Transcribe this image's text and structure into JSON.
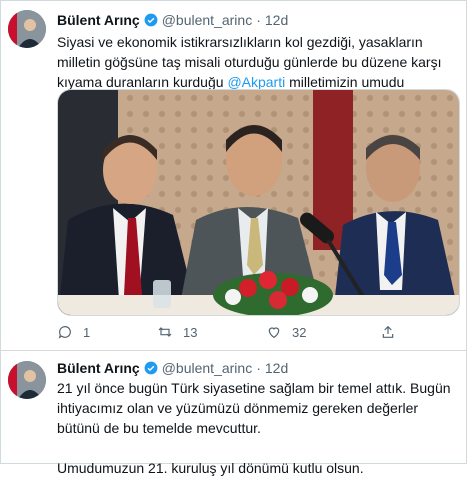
{
  "tweet1": {
    "name": "Bülent Arınç",
    "handle": "@bulent_arinc",
    "dot": "·",
    "time": "12d",
    "text_before": "Siyasi ve ekonomik istikrarsızlıkların kol gezdiği, yasakların milletin göğsüne taş misali oturduğu günlerde bu düzene karşı kıyama duranların kurduğu ",
    "mention": "@Akparti",
    "text_after": " milletimizin umudu olmuştur.",
    "actions": {
      "reply": "1",
      "retweet": "13",
      "like": "32"
    }
  },
  "tweet2": {
    "name": "Bülent Arınç",
    "handle": "@bulent_arinc",
    "dot": "·",
    "time": "12d",
    "para1": "21 yıl önce bugün Türk siyasetine sağlam bir temel attık. Bugün ihtiyacımız olan ve yüzümüzü dönmemiz gereken değerler bütünü de bu temelde mevcuttur.",
    "para2": "Umudumuzun 21. kuruluş yıl dönümü kutlu olsun."
  },
  "colors": {
    "accent": "#1d9bf0",
    "text": "#0f1419",
    "muted": "#536471"
  },
  "icons": [
    "reply-icon",
    "retweet-icon",
    "like-icon",
    "share-icon",
    "verified-badge-icon"
  ]
}
